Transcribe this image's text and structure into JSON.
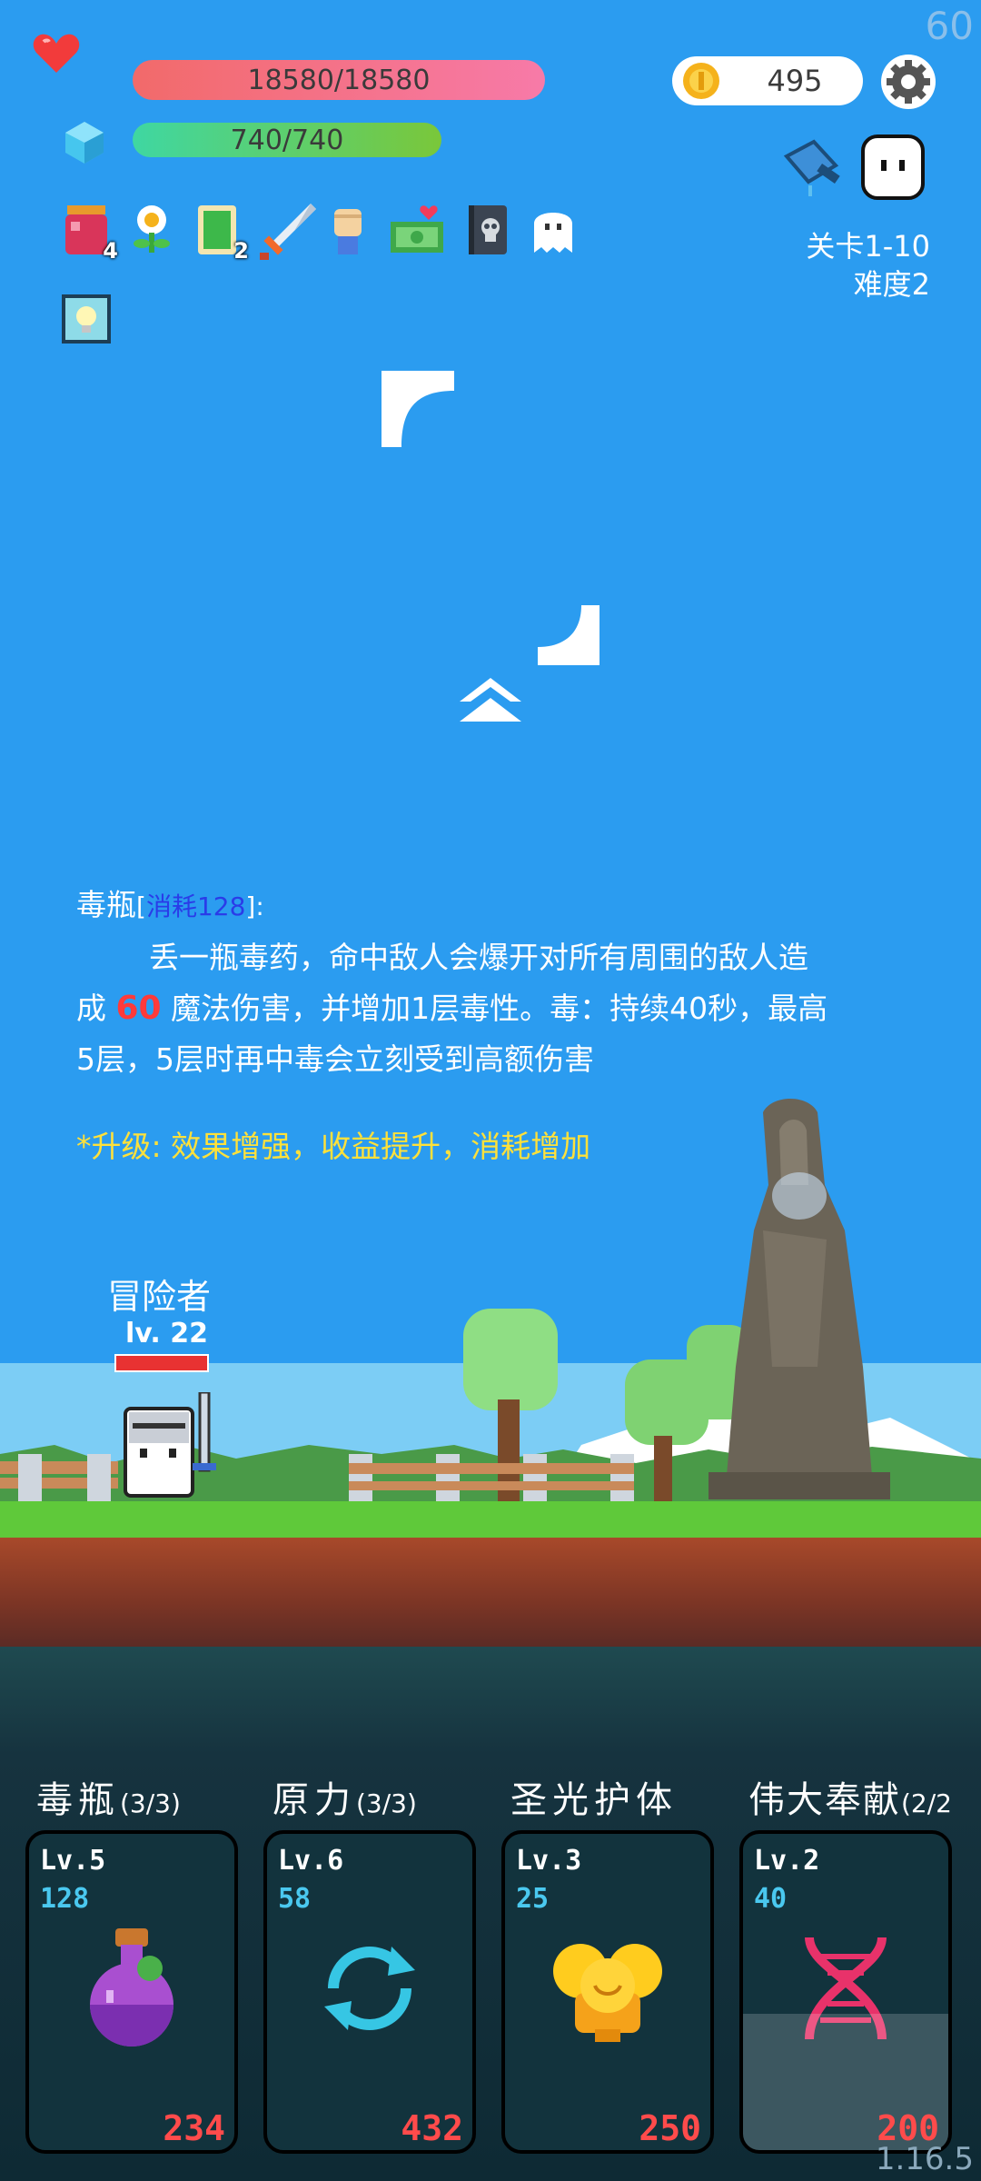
{
  "fps": "60",
  "version": "1.16.5",
  "hp": {
    "text": "18580/18580"
  },
  "mp": {
    "text": "740/740"
  },
  "gold": "495",
  "items": [
    {
      "icon": "jam-jar-icon",
      "count": "4"
    },
    {
      "icon": "flower-icon",
      "count": ""
    },
    {
      "icon": "green-card-icon",
      "count": "2"
    },
    {
      "icon": "sword-icon",
      "count": ""
    },
    {
      "icon": "fist-icon",
      "count": ""
    },
    {
      "icon": "cash-heart-icon",
      "count": ""
    },
    {
      "icon": "skull-book-icon",
      "count": ""
    },
    {
      "icon": "ghost-icon",
      "count": ""
    }
  ],
  "stage": {
    "level": "关卡1-10",
    "difficulty": "难度2"
  },
  "skill_desc": {
    "name": "毒瓶",
    "cost_open": "[",
    "cost": "消耗128",
    "cost_close": "]:",
    "line1": "丢一瓶毒药，命中敌人会爆开对所有周围的敌人造",
    "line2_pre": "成 ",
    "damage": "60",
    "line2_post": " 魔法伤害，并增加1层毒性。毒：持续40秒，最高",
    "line3": "5层，5层时再中毒会立刻受到高额伤害",
    "upgrade": "*升级: 效果增强，收益提升，消耗增加"
  },
  "hero": {
    "name": "冒险者",
    "level": "lv. 22",
    "hp_fraction": 1.0
  },
  "skills": [
    {
      "title": "毒瓶",
      "count": "(3/3)",
      "lv": "Lv.5",
      "cost": "128",
      "price": "234",
      "icon": "poison-flask-icon"
    },
    {
      "title": "原力",
      "count": "(3/3)",
      "lv": "Lv.6",
      "cost": "58",
      "price": "432",
      "icon": "refresh-cycle-icon"
    },
    {
      "title": "圣光护体",
      "count": "",
      "lv": "Lv.3",
      "cost": "25",
      "price": "250",
      "icon": "golden-angel-icon"
    },
    {
      "title": "伟大奉献",
      "count": "(2/2",
      "lv": "Lv.2",
      "cost": "40",
      "price": "200",
      "icon": "dna-icon"
    }
  ]
}
